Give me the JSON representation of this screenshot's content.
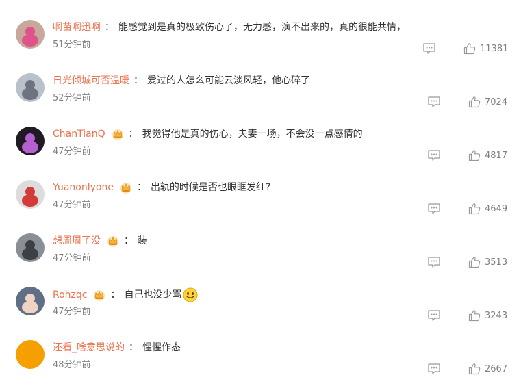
{
  "comments": [
    {
      "username": "啊苗啊迅啊",
      "vip": false,
      "text": "能感觉到是真的极致伤心了，无力感，演不出来的，真的很能共情，",
      "time": "51分钟前",
      "likes": "11381",
      "avatar_color": "#c7a89b",
      "avatar_accent": "#e0528a"
    },
    {
      "username": "日光倾城可否温暖",
      "vip": false,
      "text": "爱过的人怎么可能云淡风轻，他心碎了",
      "time": "52分钟前",
      "likes": "7024",
      "avatar_color": "#b9c1cb",
      "avatar_accent": "#6d7480"
    },
    {
      "username": "ChanTianQ",
      "vip": true,
      "text": "我觉得他是真的伤心，夫妻一场，不会没一点感情的",
      "time": "47分钟前",
      "likes": "4817",
      "avatar_color": "#1f1a24",
      "avatar_accent": "#b65fd0"
    },
    {
      "username": "Yuanonlyone",
      "vip": true,
      "text": "出轨的时候是否也眼眶发红?",
      "time": "47分钟前",
      "likes": "4649",
      "avatar_color": "#dcdcdc",
      "avatar_accent": "#d33b3b"
    },
    {
      "username": "想周周了没",
      "vip": true,
      "text": "装",
      "time": "47分钟前",
      "likes": "3513",
      "avatar_color": "#8a8f96",
      "avatar_accent": "#3c3f45"
    },
    {
      "username": "Rohzqc",
      "vip": true,
      "text": "自己也没少骂",
      "emoji": "smile",
      "time": "47分钟前",
      "likes": "3243",
      "avatar_color": "#5e6f86",
      "avatar_accent": "#f0d3c3"
    },
    {
      "username": "还看_啥意思说的",
      "vip": false,
      "text": "惺惺作态",
      "time": "48分钟前",
      "likes": "2667",
      "avatar_color": "#f5a000",
      "avatar_accent": "#f5a000"
    }
  ],
  "colors": {
    "username": "#eb7350",
    "text": "#333333",
    "meta": "#808080",
    "icon": "#9a9a9a",
    "vip_gold": "#f7b33c"
  },
  "icons": {
    "reply": "comment-icon",
    "like": "thumbs-up-icon",
    "vip": "vip-crown-icon",
    "emoji": "smile-emoji-icon"
  }
}
